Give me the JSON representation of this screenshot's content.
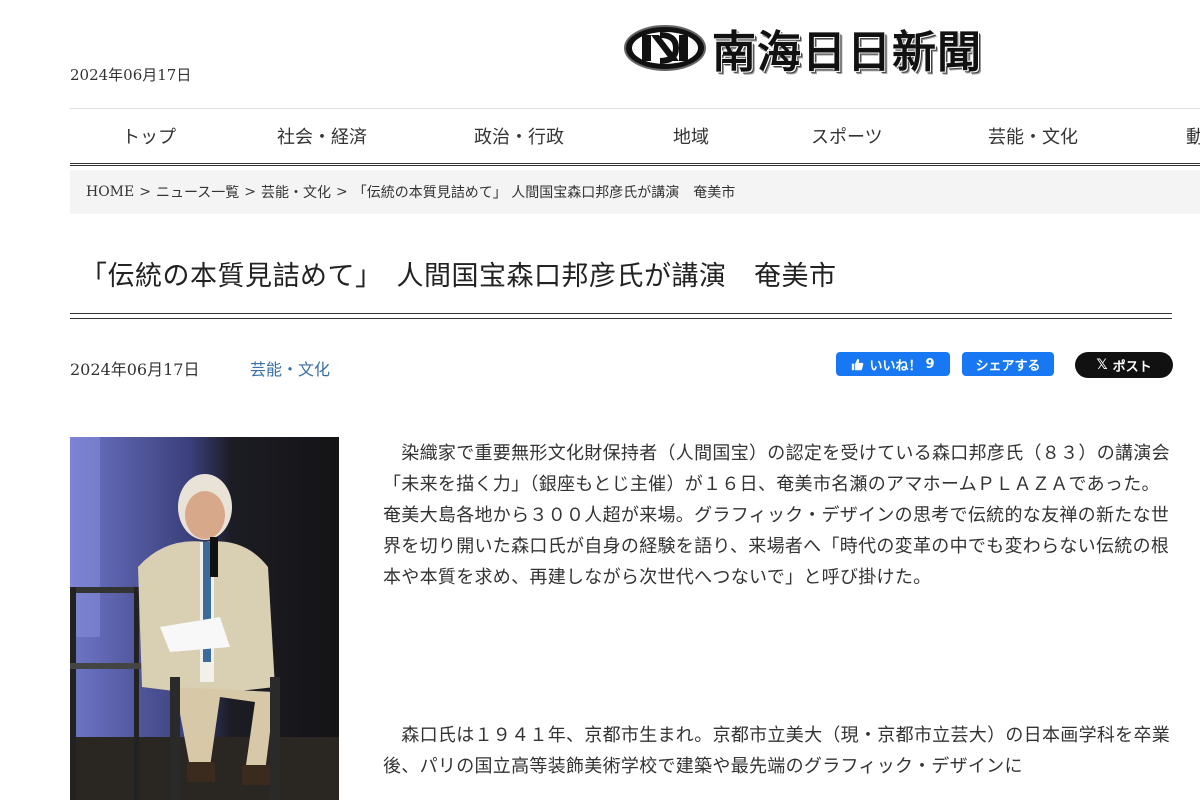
{
  "header": {
    "date": "2024年06月17日",
    "logo_text": "南海日日新聞"
  },
  "nav": {
    "items": [
      "トップ",
      "社会・経済",
      "政治・行政",
      "地域",
      "スポーツ",
      "芸能・文化",
      "動"
    ]
  },
  "breadcrumb": {
    "items": [
      "HOME",
      "ニュース一覧",
      "芸能・文化",
      "「伝統の本質見詰めて」 人間国宝森口邦彦氏が講演　奄美市"
    ],
    "separator": ">"
  },
  "article": {
    "title": "「伝統の本質見詰めて」　人間国宝森口邦彦氏が講演　奄美市",
    "date": "2024年06月17日",
    "category": "芸能・文化",
    "paragraph1": "　染織家で重要無形文化財保持者（人間国宝）の認定を受けている森口邦彦氏（８３）の講演会「未来を描く力」（銀座もとじ主催）が１６日、奄美市名瀬のアマホームＰＬＡＺＡであった。奄美大島各地から３００人超が来場。グラフィック・デザインの思考で伝統的な友禅の新たな世界を切り開いた森口氏が自身の経験を語り、来場者へ「時代の変革の中でも変わらない伝統の根本や本質を求め、再建しながら次世代へつないで」と呼び掛けた。",
    "paragraph2": "　森口氏は１９４１年、京都市生まれ。京都市立美大（現・京都市立芸大）の日本画学科を卒業後、パリの国立高等装飾美術学校で建築や最先端のグラフィック・デザインに"
  },
  "social": {
    "like_label": "いいね！",
    "like_count": "9",
    "share_label": "シェアする",
    "post_label": "ポスト",
    "post_icon_glyph": "𝕏"
  },
  "colors": {
    "facebook": "#1877f2",
    "x_button": "#111111",
    "category_link": "#3a6ea5",
    "breadcrumb_bg": "#f4f4f4"
  }
}
